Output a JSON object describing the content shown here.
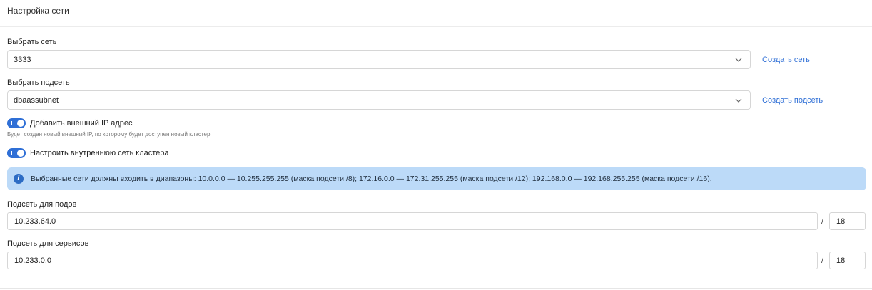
{
  "section": {
    "title": "Настройка сети"
  },
  "network": {
    "label": "Выбрать сеть",
    "value": "3333",
    "create_link": "Создать сеть"
  },
  "subnet": {
    "label": "Выбрать подсеть",
    "value": "dbaassubnet",
    "create_link": "Создать подсеть"
  },
  "external_ip": {
    "label": "Добавить внешний IP адрес",
    "enabled": true,
    "hint": "Будет создан новый внешний IP, по которому будет доступен новый кластер"
  },
  "internal_network": {
    "label": "Настроить внутреннюю сеть кластера",
    "enabled": true
  },
  "info": {
    "icon": "info-icon",
    "text": "Выбранные сети должны входить в диапазоны: 10.0.0.0 — 10.255.255.255 (маска подсети /8); 172.16.0.0 — 172.31.255.255 (маска подсети /12); 192.168.0.0 — 192.168.255.255 (маска подсети /16)."
  },
  "pod_subnet": {
    "label": "Подсеть для подов",
    "value": "10.233.64.0",
    "mask": "18"
  },
  "service_subnet": {
    "label": "Подсеть для сервисов",
    "value": "10.233.0.0",
    "mask": "18"
  },
  "separator": "/",
  "colors": {
    "accent": "#2f6fd6",
    "info_bg": "#bcdaf8",
    "info_icon": "#2c6cc4"
  }
}
